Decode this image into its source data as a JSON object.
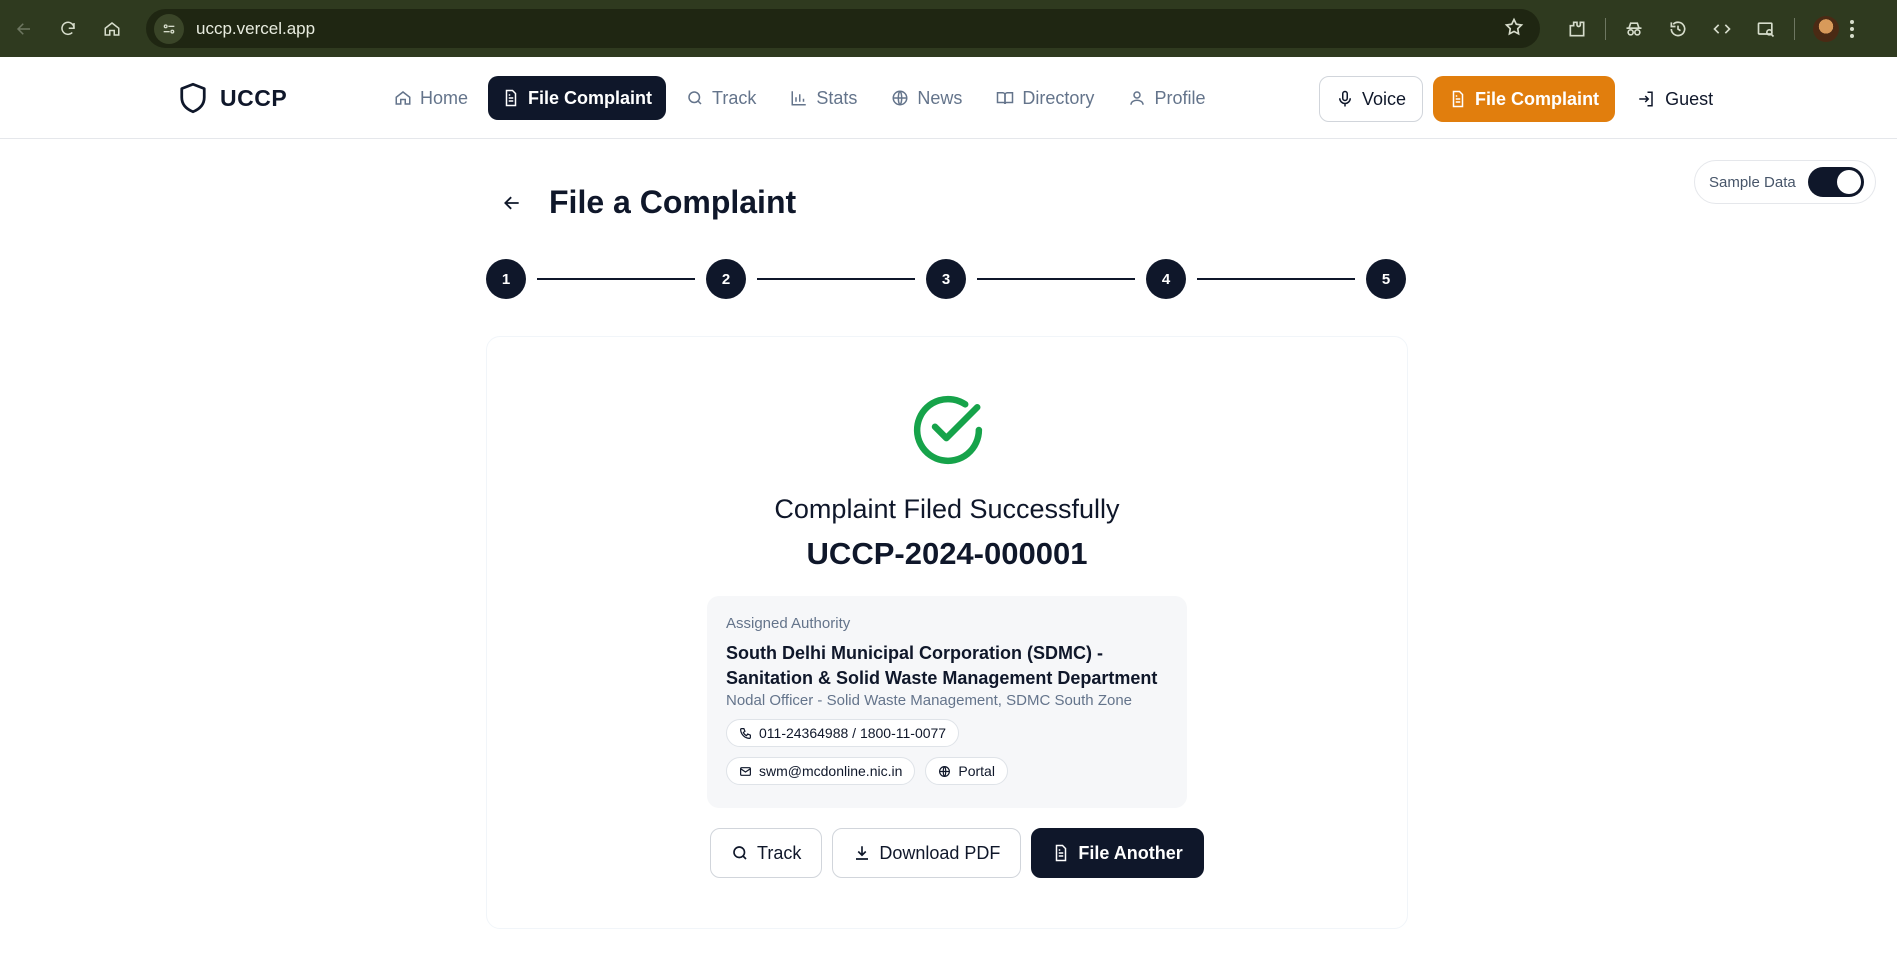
{
  "browser": {
    "url": "uccp.vercel.app"
  },
  "header": {
    "brand": "UCCP",
    "nav": [
      {
        "label": "Home",
        "icon": "home-icon"
      },
      {
        "label": "File Complaint",
        "icon": "file-icon",
        "active": true
      },
      {
        "label": "Track",
        "icon": "search-icon"
      },
      {
        "label": "Stats",
        "icon": "bar-chart-icon"
      },
      {
        "label": "News",
        "icon": "globe-icon"
      },
      {
        "label": "Directory",
        "icon": "book-icon"
      },
      {
        "label": "Profile",
        "icon": "user-icon"
      }
    ],
    "voice_label": "Voice",
    "file_label": "File Complaint",
    "guest_label": "Guest"
  },
  "sample_toggle": {
    "label": "Sample Data",
    "on": true
  },
  "page": {
    "title": "File a Complaint"
  },
  "stepper": {
    "steps": [
      "1",
      "2",
      "3",
      "4",
      "5"
    ]
  },
  "result": {
    "heading": "Complaint Filed Successfully",
    "complaint_id": "UCCP-2024-000001",
    "authority": {
      "label": "Assigned Authority",
      "name": "South Delhi Municipal Corporation (SDMC) - Sanitation & Solid Waste Management Department",
      "officer": "Nodal Officer - Solid Waste Management, SDMC South Zone",
      "phone": "011-24364988 / 1800-11-0077",
      "email": "swm@mcdonline.nic.in",
      "portal": "Portal"
    },
    "actions": {
      "track": "Track",
      "download": "Download PDF",
      "file_another": "File Another"
    }
  },
  "colors": {
    "primary": "#0f172a",
    "accent": "#e17e0d",
    "success": "#16a34a"
  }
}
